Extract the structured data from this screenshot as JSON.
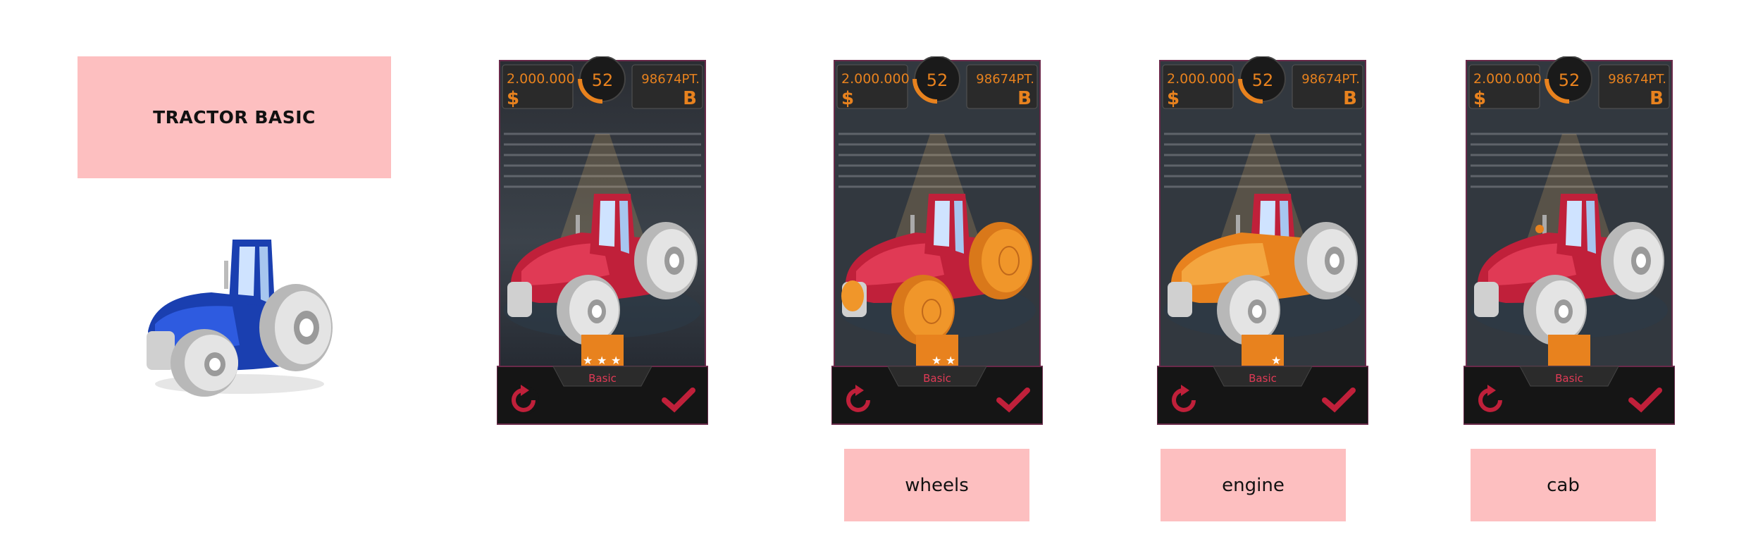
{
  "title": "TRACTOR BASIC",
  "colors": {
    "label_bg": "#fdbfc0",
    "accent_orange": "#e8821e",
    "tractor_red": "#c0203a",
    "tractor_blue": "#1a3fb0",
    "part_highlight": "#f0962a"
  },
  "cards": [
    {
      "money": "2.000.000",
      "level": "52",
      "points": "98674PT.",
      "currency_icon": "$",
      "rank_icon": "B",
      "tier": "Basic",
      "stars_filled": 3,
      "highlight": "none",
      "reset_icon": "reset-arrow-icon",
      "confirm_icon": "checkmark-icon",
      "label": ""
    },
    {
      "money": "2.000.000",
      "level": "52",
      "points": "98674PT.",
      "currency_icon": "$",
      "rank_icon": "B",
      "tier": "Basic",
      "stars_filled": 2,
      "highlight": "wheels",
      "reset_icon": "reset-arrow-icon",
      "confirm_icon": "checkmark-icon",
      "label": "wheels"
    },
    {
      "money": "2.000.000",
      "level": "52",
      "points": "98674PT.",
      "currency_icon": "$",
      "rank_icon": "B",
      "tier": "Basic",
      "stars_filled": 1,
      "highlight": "engine",
      "reset_icon": "reset-arrow-icon",
      "confirm_icon": "checkmark-icon",
      "label": "engine"
    },
    {
      "money": "2.000.000",
      "level": "52",
      "points": "98674PT.",
      "currency_icon": "$",
      "rank_icon": "B",
      "tier": "Basic",
      "stars_filled": 0,
      "highlight": "cab",
      "reset_icon": "reset-arrow-icon",
      "confirm_icon": "checkmark-icon",
      "label": "cab"
    }
  ]
}
